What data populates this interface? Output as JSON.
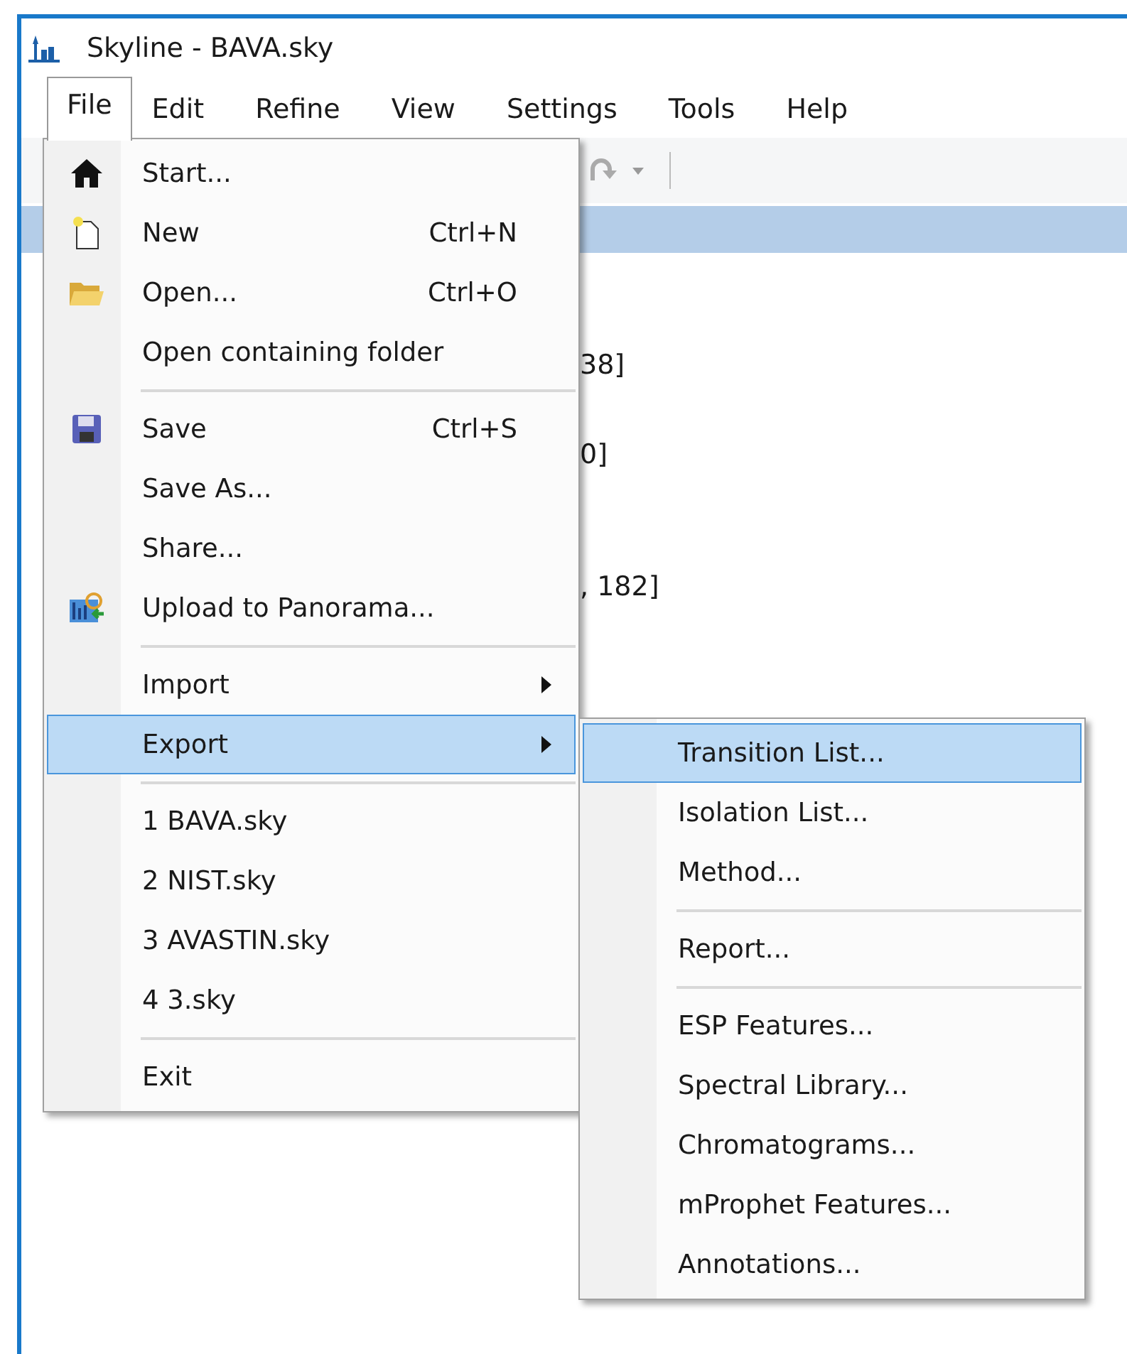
{
  "window": {
    "title": "Skyline - BAVA.sky"
  },
  "menubar": [
    {
      "label": "File",
      "selected": true
    },
    {
      "label": "Edit",
      "selected": false
    },
    {
      "label": "Refine",
      "selected": false
    },
    {
      "label": "View",
      "selected": false
    },
    {
      "label": "Settings",
      "selected": false
    },
    {
      "label": "Tools",
      "selected": false
    },
    {
      "label": "Help",
      "selected": false
    }
  ],
  "tree_fragments": [
    "38]",
    "0]",
    ", 182]"
  ],
  "file_menu": [
    {
      "kind": "item",
      "label": "Start...",
      "selected": false
    },
    {
      "kind": "item",
      "label": "New",
      "shortcut": "Ctrl+N",
      "selected": false
    },
    {
      "kind": "item",
      "label": "Open...",
      "shortcut": "Ctrl+O",
      "selected": false
    },
    {
      "kind": "item",
      "label": "Open containing folder",
      "selected": false
    },
    {
      "kind": "separator"
    },
    {
      "kind": "item",
      "label": "Save",
      "shortcut": "Ctrl+S",
      "selected": false
    },
    {
      "kind": "item",
      "label": "Save As...",
      "selected": false
    },
    {
      "kind": "item",
      "label": "Share...",
      "selected": false
    },
    {
      "kind": "item",
      "label": "Upload to Panorama...",
      "selected": false
    },
    {
      "kind": "separator"
    },
    {
      "kind": "submenu",
      "label": "Import",
      "selected": false
    },
    {
      "kind": "submenu",
      "label": "Export",
      "selected": true
    },
    {
      "kind": "separator"
    },
    {
      "kind": "item",
      "label": "1 BAVA.sky",
      "selected": false
    },
    {
      "kind": "item",
      "label": "2 NIST.sky",
      "selected": false
    },
    {
      "kind": "item",
      "label": "3 AVASTIN.sky",
      "selected": false
    },
    {
      "kind": "item",
      "label": "4 3.sky",
      "selected": false
    },
    {
      "kind": "separator"
    },
    {
      "kind": "item",
      "label": "Exit",
      "selected": false
    }
  ],
  "export_menu": [
    {
      "kind": "item",
      "label": "Transition List...",
      "selected": true
    },
    {
      "kind": "item",
      "label": "Isolation List...",
      "selected": false
    },
    {
      "kind": "item",
      "label": "Method...",
      "selected": false
    },
    {
      "kind": "separator"
    },
    {
      "kind": "item",
      "label": "Report...",
      "selected": false
    },
    {
      "kind": "separator"
    },
    {
      "kind": "item",
      "label": "ESP Features...",
      "selected": false
    },
    {
      "kind": "item",
      "label": "Spectral Library...",
      "selected": false
    },
    {
      "kind": "item",
      "label": "Chromatograms...",
      "selected": false
    },
    {
      "kind": "item",
      "label": "mProphet Features...",
      "selected": false
    },
    {
      "kind": "item",
      "label": "Annotations...",
      "selected": false
    }
  ]
}
